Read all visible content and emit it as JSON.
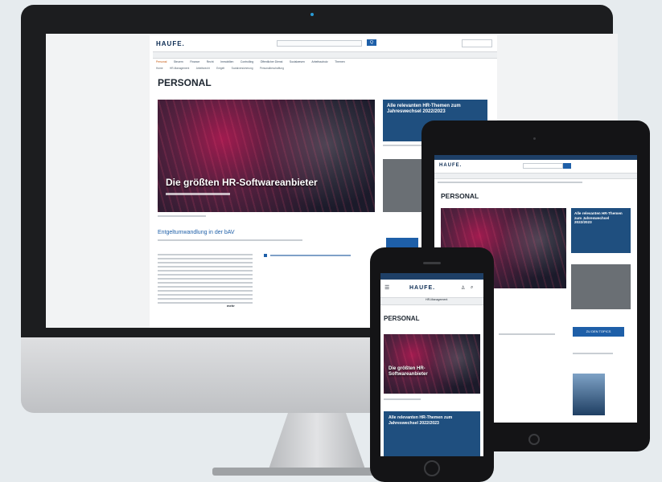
{
  "brand": {
    "logo": "HAUFE."
  },
  "desktop": {
    "nav_items": [
      "Personal",
      "Steuern",
      "Finance",
      "Recht",
      "Immobilien",
      "Controlling",
      "Öffentlicher Dienst",
      "Sozialwesen",
      "Arbeitsschutz",
      "Themen"
    ],
    "sub_items": [
      "Home",
      "HR-Management",
      "Arbeitsrecht",
      "Entgelt",
      "Sozialversicherung",
      "Personalbeschaffung"
    ],
    "section_title": "PERSONAL",
    "hero_title": "Die größten HR-Softwareanbieter",
    "teaser_title": "Entgeltumwandlung in der bAV",
    "side_card1": "Alle relevanten HR-Themen zum Jahreswechsel 2022/2023",
    "link_text": "mehr",
    "search_button": "Q"
  },
  "tablet": {
    "section_title": "PERSONAL",
    "card_title": "Alle relevanten HR-Themen zum Jahreswechsel 2022/2023",
    "button_label": "ZU DEN TOPICS"
  },
  "phone": {
    "tab_active": "HR-Management",
    "section_title": "PERSONAL",
    "hero_title": "Die größten HR-Softwareanbieter",
    "card_title": "Alle relevanten HR-Themen zum Jahreswechsel 2022/2023"
  }
}
